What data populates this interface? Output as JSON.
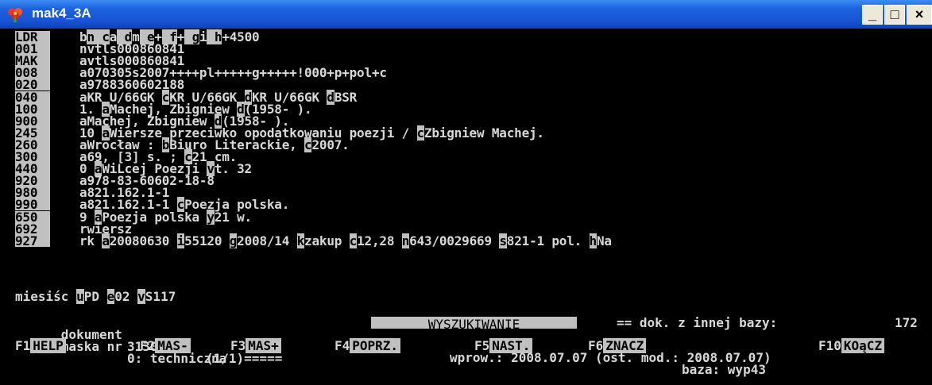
{
  "window": {
    "title": "mak4_3A",
    "min": "_",
    "max": "□",
    "close": "×"
  },
  "fields": [
    {
      "tag": "LDR",
      "parts": [
        [
          "",
          "b"
        ],
        [
          "n ",
          ""
        ],
        [
          "c",
          "a"
        ],
        [
          " ",
          ""
        ],
        [
          "d",
          "m"
        ],
        [
          " ",
          ""
        ],
        [
          "e",
          "+"
        ],
        [
          " ",
          ""
        ],
        [
          "f",
          "+"
        ],
        [
          " ",
          ""
        ],
        [
          "g",
          "i"
        ],
        [
          " ",
          ""
        ],
        [
          "h",
          "+4500"
        ]
      ]
    },
    {
      "tag": "001",
      "parts": [
        [
          "",
          "n"
        ],
        [
          "",
          "vtls000860841"
        ]
      ]
    },
    {
      "tag": "MAK",
      "parts": [
        [
          "",
          "a"
        ],
        [
          "",
          "vtls000860841"
        ]
      ]
    },
    {
      "tag": "008",
      "parts": [
        [
          "",
          "a"
        ],
        [
          "",
          "070305s2007++++pl+++++g+++++!000+p+pol+c"
        ]
      ]
    },
    {
      "tag": "020",
      "parts": [
        [
          "",
          "a"
        ],
        [
          "",
          "9788360602188"
        ]
      ]
    },
    {
      "tag": "040",
      "parts": [
        [
          "",
          "a"
        ],
        [
          "",
          "KR U/66GK "
        ],
        [
          "c",
          "KR U/66GK "
        ],
        [
          "d",
          "KR U/66GK "
        ],
        [
          "d",
          "BSR"
        ]
      ]
    },
    {
      "tag": "100",
      "parts": [
        [
          "",
          "1. "
        ],
        [
          "a",
          "Machej, Zbigniew "
        ],
        [
          "d",
          "(1958- )."
        ]
      ]
    },
    {
      "tag": "900",
      "parts": [
        [
          "",
          "a"
        ],
        [
          "",
          "Machej, Zbigniew "
        ],
        [
          "d",
          "(1958- )."
        ]
      ]
    },
    {
      "tag": "245",
      "parts": [
        [
          "",
          "10 "
        ],
        [
          "a",
          "Wiersze przeciwko opodatkowaniu poezji / "
        ],
        [
          "c",
          "Zbigniew Machej."
        ]
      ]
    },
    {
      "tag": "260",
      "parts": [
        [
          "",
          "a"
        ],
        [
          "",
          "Wrocław : "
        ],
        [
          "b",
          "Biuro Literackie, "
        ],
        [
          "c",
          "2007."
        ]
      ]
    },
    {
      "tag": "300",
      "parts": [
        [
          "",
          "a"
        ],
        [
          "",
          "69, [3] s. ; "
        ],
        [
          "c",
          "21 cm."
        ]
      ]
    },
    {
      "tag": "440",
      "parts": [
        [
          "",
          "0 "
        ],
        [
          "a",
          "WiLcej Poezji "
        ],
        [
          "v",
          "t. 32"
        ]
      ]
    },
    {
      "tag": "920",
      "parts": [
        [
          "",
          "a"
        ],
        [
          "",
          "978-83-60602-18-8"
        ]
      ]
    },
    {
      "tag": "980",
      "parts": [
        [
          "",
          "a"
        ],
        [
          "",
          "821.162.1-1"
        ]
      ]
    },
    {
      "tag": "990",
      "parts": [
        [
          "",
          "a"
        ],
        [
          "",
          "821.162.1-1 "
        ],
        [
          "c",
          "Poezja polska."
        ]
      ]
    },
    {
      "tag": "650",
      "parts": [
        [
          "",
          "9 "
        ],
        [
          "a",
          "Poezja polska "
        ],
        [
          "y",
          "21 w."
        ]
      ]
    },
    {
      "tag": "692",
      "parts": [
        [
          "",
          "r"
        ],
        [
          "",
          "wiersz"
        ]
      ]
    },
    {
      "tag": "927",
      "parts": [
        [
          "",
          "rk "
        ],
        [
          "a",
          "20080630 "
        ],
        [
          "i",
          "55120 "
        ],
        [
          "g",
          "2008/14 "
        ],
        [
          "k",
          "zakup "
        ],
        [
          "c",
          "12,28 "
        ],
        [
          "n",
          "643/0029669 "
        ],
        [
          "s",
          "821-1 pol. "
        ],
        [
          "h",
          "Na"
        ]
      ]
    }
  ],
  "continuation": [
    [
      "",
      "miesiśc "
    ],
    [
      "u",
      "PD "
    ],
    [
      "e",
      "02 "
    ],
    [
      "v",
      "S117"
    ]
  ],
  "status": {
    "dokument_label": "dokument",
    "dokument_value": "31306",
    "progress": "(1/1)=====",
    "mode": "WYSZUKIWANIE",
    "other_db": "== dok. z innej bazy:",
    "other_db_value": "172",
    "mask_label": "maska nr",
    "mask_value": "0: techniczna"
  },
  "fkeys": [
    {
      "key": "F1",
      "label": "HELP"
    },
    {
      "key": "F2",
      "label": "MAS-"
    },
    {
      "key": "F3",
      "label": "MAS+"
    },
    {
      "key": "F4",
      "label": "POPRZ."
    },
    {
      "key": "F5",
      "label": "NAST."
    },
    {
      "key": "F6",
      "label": "ZNACZ"
    },
    {
      "key": "F10",
      "label": "KOąCZ"
    }
  ],
  "footer": {
    "dates": "wprow.: 2008.07.07 (ost. mod.: 2008.07.07)",
    "base": "baza: wyp43"
  },
  "colors": {
    "background": "#000000",
    "text": "#d8d8d8",
    "highlight": "#c0c0c0",
    "title_bar": "#1955d6"
  }
}
